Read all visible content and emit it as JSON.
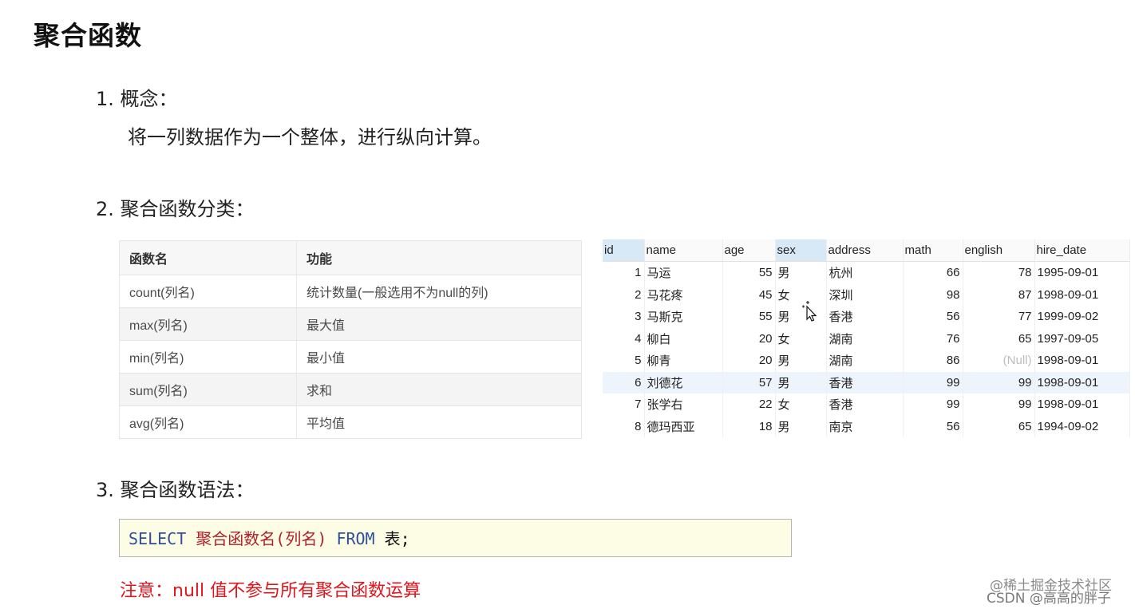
{
  "title": "聚合函数",
  "sections": {
    "concept_heading": "1.  概念：",
    "concept_text": "将一列数据作为一个整体，进行纵向计算。",
    "classify_heading": "2. 聚合函数分类：",
    "syntax_heading": "3. 聚合函数语法："
  },
  "func_table": {
    "headers": [
      "函数名",
      "功能"
    ],
    "rows": [
      [
        "count(列名)",
        "统计数量(一般选用不为null的列)"
      ],
      [
        "max(列名)",
        "最大值"
      ],
      [
        "min(列名)",
        "最小值"
      ],
      [
        "sum(列名)",
        "求和"
      ],
      [
        "avg(列名)",
        "平均值"
      ]
    ]
  },
  "grid": {
    "headers": [
      "id",
      "name",
      "age",
      "sex",
      "address",
      "math",
      "english",
      "hire_date"
    ],
    "rows": [
      [
        "1",
        "马运",
        "55",
        "男",
        "杭州",
        "66",
        "78",
        "1995-09-01"
      ],
      [
        "2",
        "马花疼",
        "45",
        "女",
        "深圳",
        "98",
        "87",
        "1998-09-01"
      ],
      [
        "3",
        "马斯克",
        "55",
        "男",
        "香港",
        "56",
        "77",
        "1999-09-02"
      ],
      [
        "4",
        "柳白",
        "20",
        "女",
        "湖南",
        "76",
        "65",
        "1997-09-05"
      ],
      [
        "5",
        "柳青",
        "20",
        "男",
        "湖南",
        "86",
        "(Null)",
        "1998-09-01"
      ],
      [
        "6",
        "刘德花",
        "57",
        "男",
        "香港",
        "99",
        "99",
        "1998-09-01"
      ],
      [
        "7",
        "张学右",
        "22",
        "女",
        "香港",
        "99",
        "99",
        "1998-09-01"
      ],
      [
        "8",
        "德玛西亚",
        "18",
        "男",
        "南京",
        "56",
        "65",
        "1994-09-02"
      ]
    ]
  },
  "code": {
    "kw_select": "SELECT",
    "fn_part": "聚合函数名(列名)",
    "kw_from": "FROM",
    "table_part": "表;"
  },
  "note": "注意：null 值不参与所有聚合函数运算",
  "watermark": {
    "line1": "@稀土掘金技术社区",
    "line2": "CSDN @高高的胖子"
  }
}
